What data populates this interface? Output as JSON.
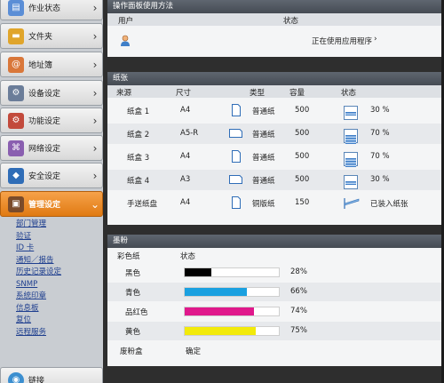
{
  "sidebar": {
    "items": [
      {
        "label": "作业状态",
        "icon": "job-status-icon",
        "color": "#5b8ed6"
      },
      {
        "label": "文件夹",
        "icon": "folder-icon",
        "color": "#e0a52b"
      },
      {
        "label": "地址簿",
        "icon": "address-book-icon",
        "color": "#d9773a"
      },
      {
        "label": "设备设定",
        "icon": "device-settings-icon",
        "color": "#6b7d99"
      },
      {
        "label": "功能设定",
        "icon": "function-settings-icon",
        "color": "#c24a3c"
      },
      {
        "label": "网络设定",
        "icon": "network-settings-icon",
        "color": "#8a5fb0"
      },
      {
        "label": "安全设定",
        "icon": "security-shield-icon",
        "color": "#2f6db7"
      },
      {
        "label": "管理设定",
        "icon": "management-settings-icon",
        "color": "#7a4b2a",
        "active": true
      }
    ],
    "submenu": [
      "部门管理",
      "验证",
      "ID 卡",
      "通知／报告",
      "历史记录设定",
      "SNMP",
      "系统印章",
      "信息板",
      "复位",
      "远程服务"
    ],
    "bottom_item": {
      "label": "链接",
      "icon": "link-globe-icon",
      "color": "#3c8fd0"
    }
  },
  "panel_usage": {
    "title": "操作面板使用方法",
    "col_user": "用户",
    "col_status": "状态",
    "user_icon": "user-person-icon",
    "status_text": "正在使用应用程序"
  },
  "panel_paper": {
    "title": "纸张",
    "headers": {
      "source": "来源",
      "size": "尺寸",
      "type": "类型",
      "capacity": "容量",
      "status": "状态"
    },
    "rows": [
      {
        "source": "纸盒 1",
        "size": "A4",
        "type": "普通纸",
        "capacity": "500",
        "status": "30 %",
        "level": 0.3,
        "orientation": "portrait"
      },
      {
        "source": "纸盒 2",
        "size": "A5-R",
        "type": "普通纸",
        "capacity": "500",
        "status": "70 %",
        "level": 0.7,
        "orientation": "landscape"
      },
      {
        "source": "纸盒 3",
        "size": "A4",
        "type": "普通纸",
        "capacity": "500",
        "status": "70 %",
        "level": 0.7,
        "orientation": "portrait"
      },
      {
        "source": "纸盒 4",
        "size": "A3",
        "type": "普通纸",
        "capacity": "500",
        "status": "30 %",
        "level": 0.3,
        "orientation": "landscape"
      },
      {
        "source": "手送纸盘",
        "size": "A4",
        "type": "铜版纸",
        "capacity": "150",
        "status": "已装入纸张",
        "level": 0.5,
        "orientation": "portrait",
        "manual_feed": true
      }
    ]
  },
  "panel_toner": {
    "title": "墨粉",
    "headers": {
      "color": "彩色纸",
      "status": "状态"
    },
    "rows": [
      {
        "name": "黑色",
        "percent": "28%",
        "level": 0.28,
        "color": "#000000"
      },
      {
        "name": "青色",
        "percent": "66%",
        "level": 0.66,
        "color": "#1aa0e0"
      },
      {
        "name": "品红色",
        "percent": "74%",
        "level": 0.74,
        "color": "#e0198c"
      },
      {
        "name": "黄色",
        "percent": "75%",
        "level": 0.75,
        "color": "#f2ea0a"
      }
    ],
    "waste": {
      "name": "废粉盒",
      "status": "确定"
    }
  }
}
